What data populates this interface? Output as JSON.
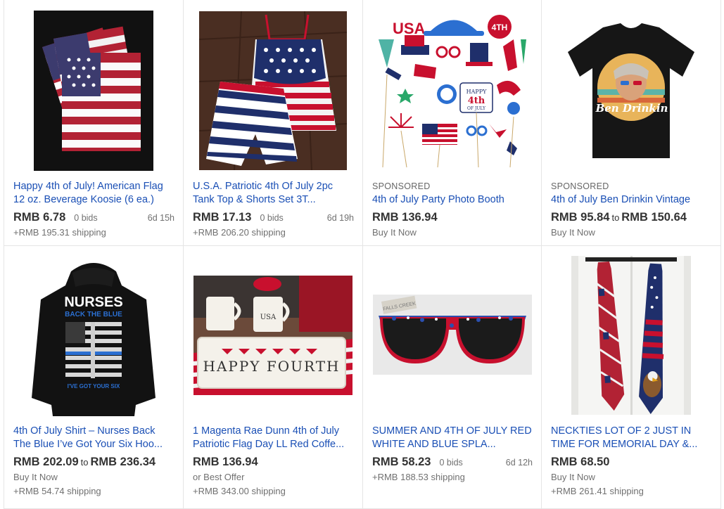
{
  "listings": [
    {
      "sponsored": "",
      "title": "Happy 4th of July! American Flag 12 oz. Beverage Koosie (6 ea.)",
      "price": "RMB 6.78",
      "price_to": "",
      "price_max": "",
      "bids": "0 bids",
      "time_left": "6d 15h",
      "buy_format": "",
      "shipping": "+RMB 195.31 shipping",
      "image": "flag-koozie-image"
    },
    {
      "sponsored": "",
      "title": "U.S.A. Patriotic 4th Of July 2pc Tank Top & Shorts Set 3T...",
      "price": "RMB 17.13",
      "price_to": "",
      "price_max": "",
      "bids": "0 bids",
      "time_left": "6d 19h",
      "buy_format": "",
      "shipping": "+RMB 206.20 shipping",
      "image": "tank-top-shorts-image"
    },
    {
      "sponsored": "SPONSORED",
      "title": "4th of July Party Photo Booth",
      "price": "RMB 136.94",
      "price_to": "",
      "price_max": "",
      "bids": "",
      "time_left": "",
      "buy_format": "Buy It Now",
      "shipping": "",
      "image": "photo-booth-props-image"
    },
    {
      "sponsored": "SPONSORED",
      "title": "4th of July Ben Drinkin Vintage",
      "price": "RMB 95.84",
      "price_to": "to",
      "price_max": "RMB 150.64",
      "bids": "",
      "time_left": "",
      "buy_format": "Buy It Now",
      "shipping": "",
      "image": "ben-drinkin-shirt-image",
      "shirt_text": "Ben Drinkin"
    },
    {
      "sponsored": "",
      "title": "4th Of July Shirt – Nurses Back The Blue I’ve Got Your Six Hoo...",
      "price": "RMB 202.09",
      "price_to": "to",
      "price_max": "RMB 236.34",
      "bids": "",
      "time_left": "",
      "buy_format": "Buy It Now",
      "shipping": "+RMB 54.74 shipping",
      "image": "nurses-hoodie-image",
      "hoodie_text_1": "NURSES",
      "hoodie_text_2": "BACK THE BLUE",
      "hoodie_text_3": "I'VE GOT YOUR SIX"
    },
    {
      "sponsored": "",
      "title": "1 Magenta Rae Dunn 4th of July Patriotic Flag Day LL Red Coffe...",
      "price": "RMB 136.94",
      "price_to": "",
      "price_max": "",
      "bids": "",
      "time_left": "",
      "buy_format": "or Best Offer",
      "shipping": "+RMB 343.00 shipping",
      "image": "rae-dunn-tray-image",
      "tray_text": "HAPPY FOURTH",
      "mug_text": "USA"
    },
    {
      "sponsored": "",
      "title": "SUMMER AND 4TH OF JULY RED WHITE AND BLUE SPLA...",
      "price": "RMB 58.23",
      "price_to": "",
      "price_max": "",
      "bids": "0 bids",
      "time_left": "6d 12h",
      "buy_format": "",
      "shipping": "+RMB 188.53 shipping",
      "image": "sunglasses-image",
      "tag_text": "FALLS CREEK"
    },
    {
      "sponsored": "",
      "title": "NECKTIES LOT OF 2 JUST IN TIME FOR MEMORIAL DAY &...",
      "price": "RMB 68.50",
      "price_to": "",
      "price_max": "",
      "bids": "",
      "time_left": "",
      "buy_format": "Buy It Now",
      "shipping": "+RMB 261.41 shipping",
      "image": "neckties-image"
    }
  ],
  "colors": {
    "link": "#1a4fb5",
    "flag_red": "#c8102e",
    "flag_blue": "#1f2f6b"
  }
}
